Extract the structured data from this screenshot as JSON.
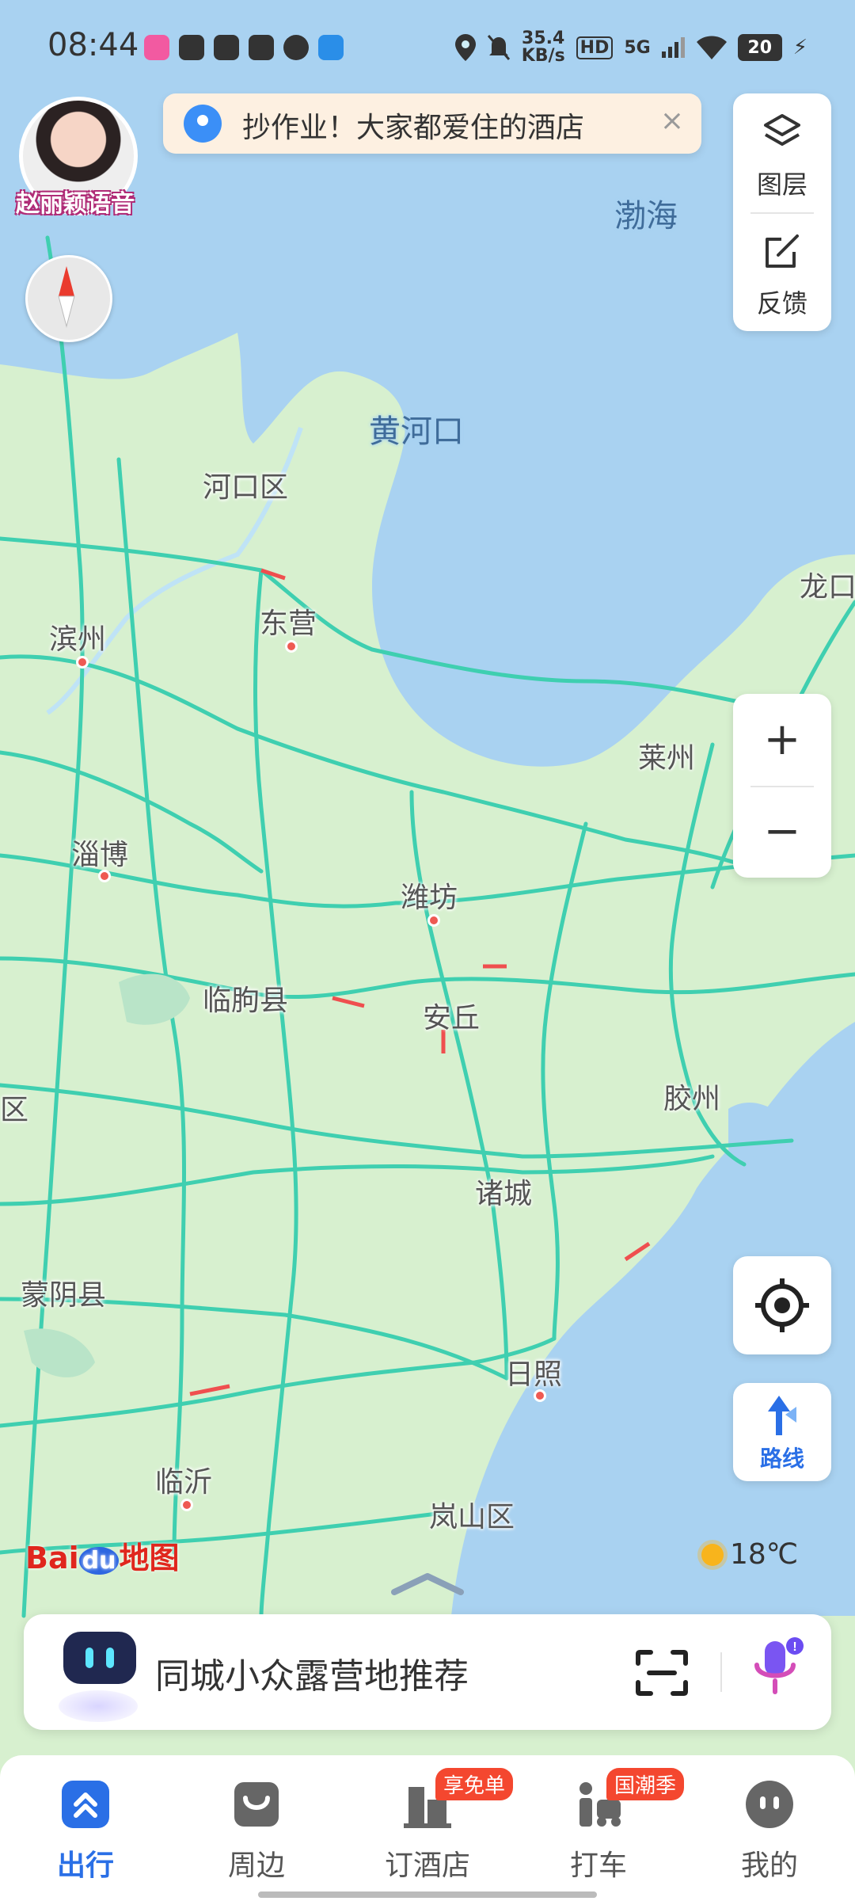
{
  "status_bar": {
    "time": "08:44",
    "network_speed_value": "35.4",
    "network_speed_unit": "KB/s",
    "hd": "HD",
    "net_type": "5G",
    "battery": "20",
    "icons": [
      "location-icon",
      "mute-bell-icon",
      "wifi-icon",
      "signal-icon",
      "charging-icon"
    ]
  },
  "voice_assistant": {
    "label": "赵丽颖语音"
  },
  "banner": {
    "text": "抄作业！大家都爱住的酒店",
    "close": "×"
  },
  "layers_panel": {
    "layers_label": "图层",
    "feedback_label": "反馈"
  },
  "zoom": {
    "in": "+",
    "out": "−"
  },
  "map": {
    "provider": "Bai地图",
    "sea_labels": [
      "渤海",
      "黄河口"
    ],
    "place_labels": [
      "河口区",
      "东营",
      "滨州",
      "淄博",
      "潍坊",
      "临朐县",
      "安丘",
      "莱州",
      "龙口",
      "胶州",
      "诸城",
      "区",
      "蒙阴县",
      "日照",
      "临沂",
      "岚山区"
    ]
  },
  "route_button": {
    "label": "路线"
  },
  "weather": {
    "temperature": "18℃"
  },
  "search": {
    "text": "同城小众露营地推荐"
  },
  "nav": [
    {
      "label": "出行",
      "badge": ""
    },
    {
      "label": "周边",
      "badge": ""
    },
    {
      "label": "订酒店",
      "badge": "享免单"
    },
    {
      "label": "打车",
      "badge": "国潮季"
    },
    {
      "label": "我的",
      "badge": ""
    }
  ],
  "colors": {
    "accent": "#2a6fe6",
    "road": "#3fcfb0",
    "sea": "#a9d2f1",
    "land": "#d7f0cf"
  }
}
